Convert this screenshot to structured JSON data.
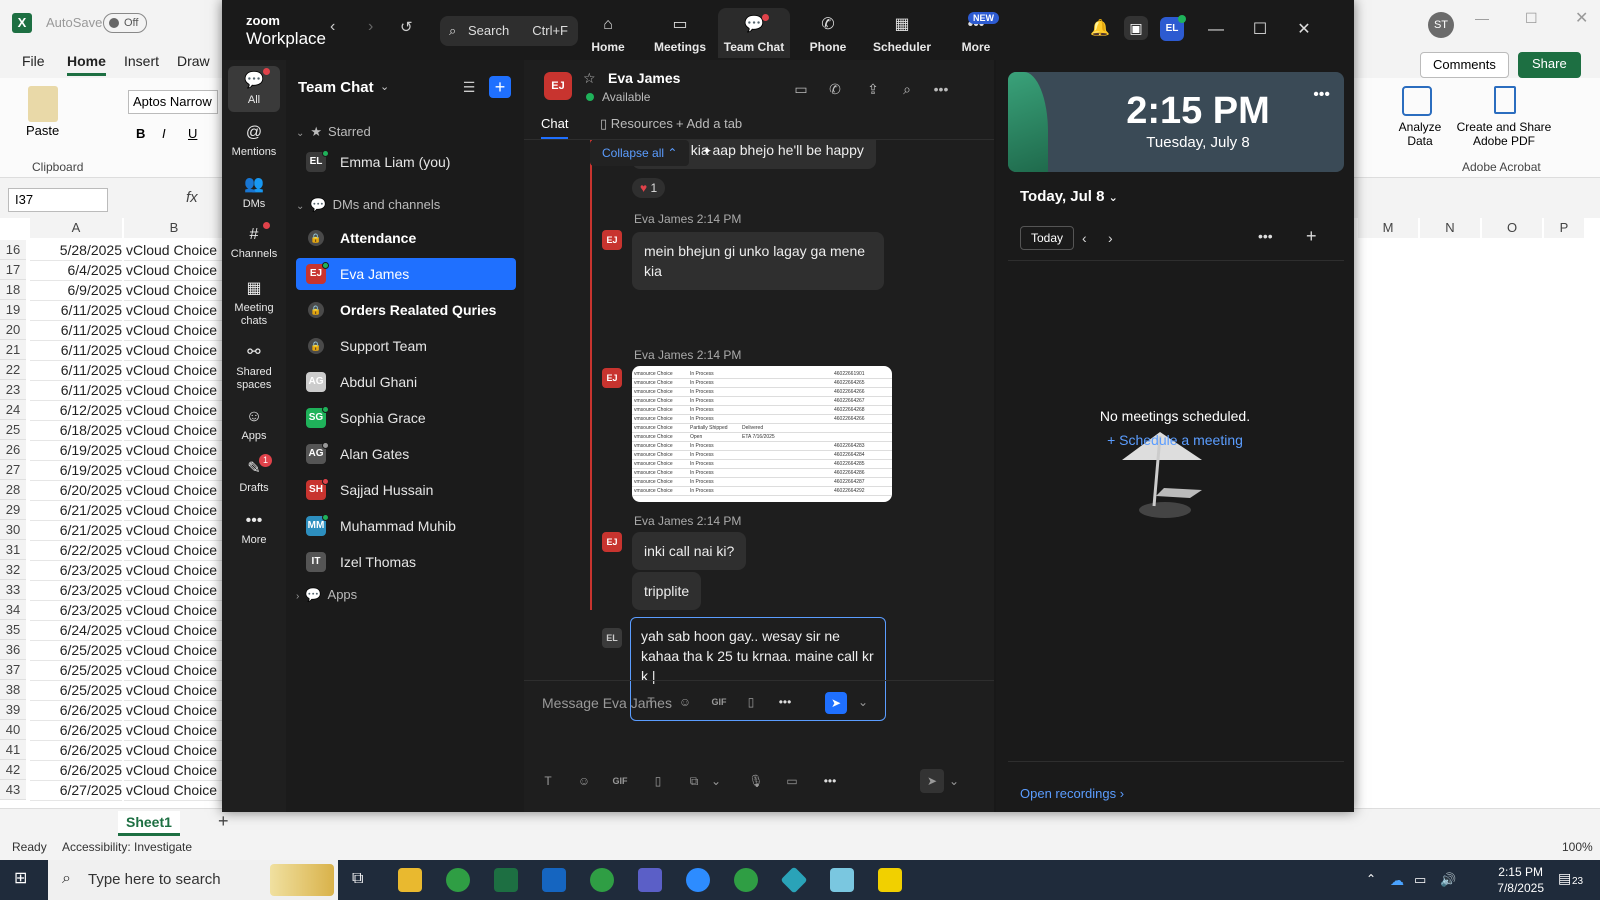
{
  "excel": {
    "autosave": "AutoSave",
    "autosave_state": "Off",
    "menus": [
      "File",
      "Home",
      "Insert",
      "Draw"
    ],
    "font": "Aptos Narrow",
    "paste": "Paste",
    "clipboard": "Clipboard",
    "name_box": "I37",
    "fx": "fx",
    "col_a": "A",
    "col_b": "B",
    "right_cols": [
      "M",
      "N",
      "O",
      "P"
    ],
    "comments": "Comments",
    "share": "Share",
    "analyze": "Analyze Data",
    "create_pdf": "Create and Share Adobe PDF",
    "adobe_group": "Adobe Acrobat",
    "user_initials": "ST",
    "sheet": "Sheet1",
    "status_ready": "Ready",
    "accessibility": "Accessibility: Investigate",
    "zoom_pct": "100%",
    "rows": [
      {
        "n": "16",
        "a": "5/28/2025",
        "b": "vCloud Choice"
      },
      {
        "n": "17",
        "a": "6/4/2025",
        "b": "vCloud Choice"
      },
      {
        "n": "18",
        "a": "6/9/2025",
        "b": "vCloud Choice"
      },
      {
        "n": "19",
        "a": "6/11/2025",
        "b": "vCloud Choice"
      },
      {
        "n": "20",
        "a": "6/11/2025",
        "b": "vCloud Choice"
      },
      {
        "n": "21",
        "a": "6/11/2025",
        "b": "vCloud Choice"
      },
      {
        "n": "22",
        "a": "6/11/2025",
        "b": "vCloud Choice"
      },
      {
        "n": "23",
        "a": "6/11/2025",
        "b": "vCloud Choice"
      },
      {
        "n": "24",
        "a": "6/12/2025",
        "b": "vCloud Choice"
      },
      {
        "n": "25",
        "a": "6/18/2025",
        "b": "vCloud Choice"
      },
      {
        "n": "26",
        "a": "6/19/2025",
        "b": "vCloud Choice"
      },
      {
        "n": "27",
        "a": "6/19/2025",
        "b": "vCloud Choice"
      },
      {
        "n": "28",
        "a": "6/20/2025",
        "b": "vCloud Choice"
      },
      {
        "n": "29",
        "a": "6/21/2025",
        "b": "vCloud Choice"
      },
      {
        "n": "30",
        "a": "6/21/2025",
        "b": "vCloud Choice"
      },
      {
        "n": "31",
        "a": "6/22/2025",
        "b": "vCloud Choice"
      },
      {
        "n": "32",
        "a": "6/23/2025",
        "b": "vCloud Choice"
      },
      {
        "n": "33",
        "a": "6/23/2025",
        "b": "vCloud Choice"
      },
      {
        "n": "34",
        "a": "6/23/2025",
        "b": "vCloud Choice"
      },
      {
        "n": "35",
        "a": "6/24/2025",
        "b": "vCloud Choice"
      },
      {
        "n": "36",
        "a": "6/25/2025",
        "b": "vCloud Choice"
      },
      {
        "n": "37",
        "a": "6/25/2025",
        "b": "vCloud Choice"
      },
      {
        "n": "38",
        "a": "6/25/2025",
        "b": "vCloud Choice"
      },
      {
        "n": "39",
        "a": "6/26/2025",
        "b": "vCloud Choice"
      },
      {
        "n": "40",
        "a": "6/26/2025",
        "b": "vCloud Choice"
      },
      {
        "n": "41",
        "a": "6/26/2025",
        "b": "vCloud Choice"
      },
      {
        "n": "42",
        "a": "6/26/2025",
        "b": "vCloud Choice"
      },
      {
        "n": "43",
        "a": "6/27/2025",
        "b": "vCloud Choice"
      }
    ]
  },
  "zoom": {
    "brand_top": "zoom",
    "brand_bottom": "Workplace",
    "search_label": "Search",
    "search_shortcut": "Ctrl+F",
    "nav": [
      {
        "label": "Home",
        "icon": "home-icon",
        "glyph": "⌂"
      },
      {
        "label": "Meetings",
        "icon": "video-icon",
        "glyph": "▭"
      },
      {
        "label": "Team Chat",
        "icon": "chat-icon",
        "glyph": "💬"
      },
      {
        "label": "Phone",
        "icon": "phone-icon",
        "glyph": "✆"
      },
      {
        "label": "Scheduler",
        "icon": "calendar-icon",
        "glyph": "▦"
      },
      {
        "label": "More",
        "icon": "more-icon",
        "glyph": "•••"
      }
    ],
    "new_badge": "NEW",
    "user_initials": "EL",
    "rail": [
      {
        "label": "All",
        "glyph": "💬"
      },
      {
        "label": "Mentions",
        "glyph": "@"
      },
      {
        "label": "DMs",
        "glyph": "👥"
      },
      {
        "label": "Channels",
        "glyph": "#"
      },
      {
        "label": "Meeting chats",
        "glyph": "▦"
      },
      {
        "label": "Shared spaces",
        "glyph": "⚯"
      },
      {
        "label": "Apps",
        "glyph": "☺"
      },
      {
        "label": "Drafts",
        "glyph": "✎",
        "badge": "1"
      },
      {
        "label": "More",
        "glyph": "•••"
      }
    ],
    "list": {
      "title": "Team Chat",
      "starred": "Starred",
      "dms_channels": "DMs and channels",
      "apps": "Apps",
      "starred_items": [
        {
          "name": "Emma Liam (you)",
          "initials": "EL",
          "color": "#3a3a3a",
          "status": "#1fb25a"
        }
      ],
      "items": [
        {
          "name": "Attendance",
          "type": "channel",
          "bold": true
        },
        {
          "name": "Eva James",
          "type": "dm",
          "initials": "EJ",
          "color": "#c8342f",
          "status": "#1fb25a",
          "selected": true
        },
        {
          "name": "Orders Realated Quries",
          "type": "channel",
          "bold": true
        },
        {
          "name": "Support Team",
          "type": "channel"
        },
        {
          "name": "Abdul Ghani",
          "type": "dm",
          "initials": "AG",
          "color": "#ccc",
          "status": ""
        },
        {
          "name": "Sophia Grace",
          "type": "dm",
          "initials": "SG",
          "color": "#1fb25a",
          "status": "#1fb25a"
        },
        {
          "name": "Alan Gates",
          "type": "dm",
          "initials": "AG",
          "color": "#555",
          "status": "#999"
        },
        {
          "name": "Sajjad Hussain",
          "type": "dm",
          "initials": "SH",
          "color": "#c8342f",
          "status": "#e0424a"
        },
        {
          "name": "Muhammad Muhib",
          "type": "dm",
          "initials": "MM",
          "color": "#2d8fbf",
          "status": "#1fb25a"
        },
        {
          "name": "Izel Thomas",
          "type": "dm",
          "initials": "IT",
          "color": "#555",
          "status": ""
        }
      ]
    },
    "chat": {
      "contact_name": "Eva James",
      "contact_initials": "EJ",
      "contact_status": "Available",
      "tabs": [
        "Chat",
        "Resources",
        "Add a tab"
      ],
      "collapse_all": "Collapse all",
      "prev_message_fragment": "aap ne kia aap bhejo he'll be happy",
      "reaction_count": "1",
      "messages": [
        {
          "sender": "Eva James",
          "time": "2:14 PM",
          "text": "mein bhejun gi unko lagay ga mene kia"
        },
        {
          "sender": "Eva James",
          "time": "2:14 PM",
          "text": "[image]"
        },
        {
          "sender": "Eva James",
          "time": "2:14 PM",
          "text": "inki call nai ki?"
        },
        {
          "sender": "Eva James",
          "time": "",
          "text": "tripplite"
        }
      ],
      "image_rows": [
        {
          "c1": "vmsource Choice",
          "c2": "In Process",
          "c3": "",
          "c4": "46022661901"
        },
        {
          "c1": "vmsource Choice",
          "c2": "In Process",
          "c3": "",
          "c4": "46022664265"
        },
        {
          "c1": "vmsource Choice",
          "c2": "In Process",
          "c3": "",
          "c4": "46022664266"
        },
        {
          "c1": "vmsource Choice",
          "c2": "In Process",
          "c3": "",
          "c4": "46022664267"
        },
        {
          "c1": "vmsource Choice",
          "c2": "In Process",
          "c3": "",
          "c4": "46022664268"
        },
        {
          "c1": "vmsource Choice",
          "c2": "In Process",
          "c3": "",
          "c4": "46022664266"
        },
        {
          "c1": "vmsource Choice",
          "c2": "Partially Shipped",
          "c3": "Delivered",
          "c4": ""
        },
        {
          "c1": "vmsource Choice",
          "c2": "Open",
          "c3": "ETA 7/16/2025",
          "c4": ""
        },
        {
          "c1": "vmsource Choice",
          "c2": "In Process",
          "c3": "",
          "c4": "46022664283"
        },
        {
          "c1": "vmsource Choice",
          "c2": "In Process",
          "c3": "",
          "c4": "46022664284"
        },
        {
          "c1": "vmsource Choice",
          "c2": "In Process",
          "c3": "",
          "c4": "46022664285"
        },
        {
          "c1": "vmsource Choice",
          "c2": "In Process",
          "c3": "",
          "c4": "46022664286"
        },
        {
          "c1": "vmsource Choice",
          "c2": "In Process",
          "c3": "",
          "c4": "46022664287"
        },
        {
          "c1": "vmsource Choice",
          "c2": "In Process",
          "c3": "",
          "c4": "46022664292"
        }
      ],
      "draft_initials": "EL",
      "draft_text": "yah sab hoon gay.. wesay sir ne kahaa tha k 25 tu krnaa. maine call kr k |",
      "composer_placeholder": "Message Eva James"
    },
    "right": {
      "time": "2:15 PM",
      "date": "Tuesday, July 8",
      "today_header": "Today, Jul 8",
      "today_btn": "Today",
      "empty": "No meetings scheduled.",
      "schedule": "+ Schedule a meeting",
      "open_recordings": "Open recordings ›"
    }
  },
  "taskbar": {
    "search_placeholder": "Type here to search",
    "time": "2:15 PM",
    "date": "7/8/2025",
    "notif_count": "23"
  }
}
